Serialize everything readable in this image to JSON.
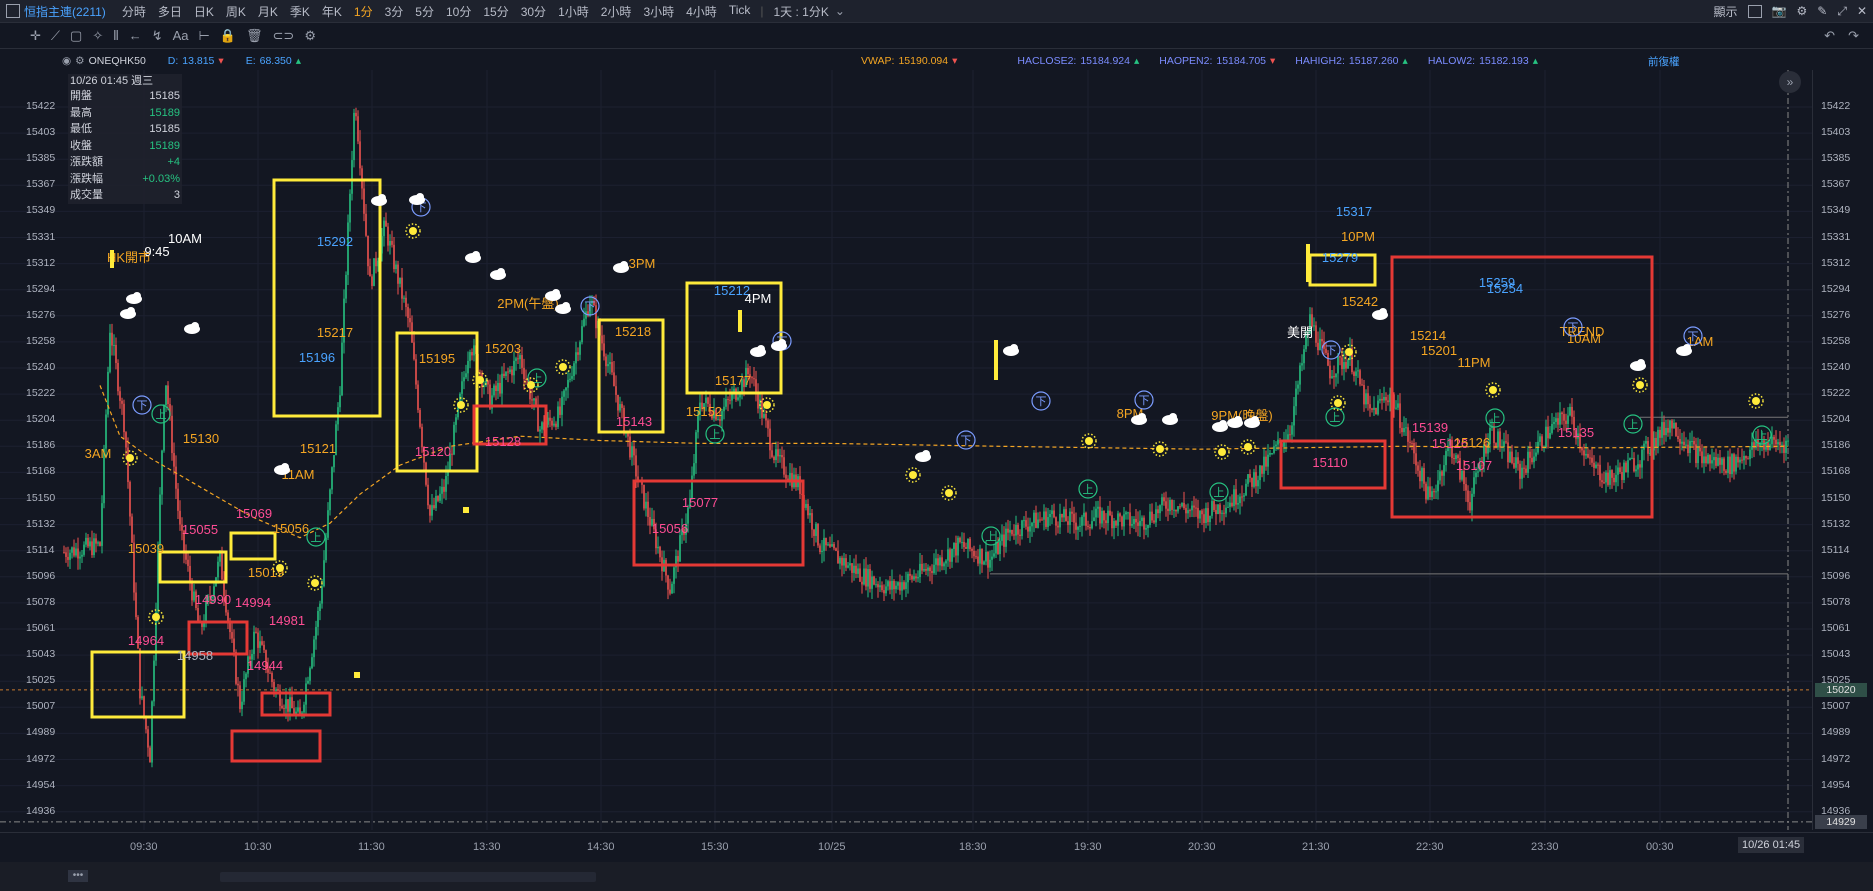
{
  "header": {
    "symbol": "恒指主連(2211)",
    "intervals": [
      "分時",
      "多日",
      "日K",
      "周K",
      "月K",
      "季K",
      "年K",
      "1分",
      "3分",
      "5分",
      "10分",
      "15分",
      "30分",
      "1小時",
      "2小時",
      "3小時",
      "4小時",
      "Tick"
    ],
    "active_interval": "1分",
    "period_select": "1天 : 1分K",
    "display_label": "顯示"
  },
  "indicator_bar": {
    "symbol": "ONEQHK50",
    "d_label": "D:",
    "d_value": "13.815",
    "e_label": "E:",
    "e_value": "68.350",
    "vwap_label": "VWAP:",
    "vwap_value": "15190.094",
    "haclose_label": "HACLOSE2:",
    "haclose_value": "15184.924",
    "haopen_label": "HAOPEN2:",
    "haopen_value": "15184.705",
    "hahigh_label": "HAHIGH2:",
    "hahigh_value": "15187.260",
    "halow_label": "HALOW2:",
    "halow_value": "15182.193",
    "adjust_label": "前復權"
  },
  "ohlc_panel": {
    "date": "10/26 01:45 週三",
    "rows": [
      {
        "label": "開盤",
        "value": "15185",
        "color": "#d0d3dc"
      },
      {
        "label": "最高",
        "value": "15189",
        "color": "#26c281"
      },
      {
        "label": "最低",
        "value": "15185",
        "color": "#d0d3dc"
      },
      {
        "label": "收盤",
        "value": "15189",
        "color": "#26c281"
      },
      {
        "label": "漲跌額",
        "value": "+4",
        "color": "#26c281"
      },
      {
        "label": "漲跌幅",
        "value": "+0.03%",
        "color": "#26c281"
      },
      {
        "label": "成交量",
        "value": "3",
        "color": "#d0d3dc"
      }
    ]
  },
  "y_axis": {
    "ticks": [
      "15422",
      "15403",
      "15385",
      "15367",
      "15349",
      "15331",
      "15312",
      "15294",
      "15276",
      "15258",
      "15240",
      "15222",
      "15204",
      "15186",
      "15168",
      "15150",
      "15132",
      "15114",
      "15096",
      "15078",
      "15061",
      "15043",
      "15025",
      "15007",
      "14989",
      "14972",
      "14954",
      "14936"
    ],
    "current_price": "15020",
    "low_price": "14929"
  },
  "x_axis": {
    "ticks": [
      "09:30",
      "10:30",
      "11:30",
      "13:30",
      "14:30",
      "15:30",
      "10/25",
      "18:30",
      "19:30",
      "20:30",
      "21:30",
      "22:30",
      "23:30",
      "00:30"
    ],
    "cursor_label": "10/26 01:45"
  },
  "colors": {
    "up": "#26c281",
    "down": "#ef5350",
    "vwap": "#f5a623",
    "yellow_box": "#ffeb3b",
    "red_box": "#e53935"
  },
  "chart_data": {
    "type": "candlestick",
    "price_range": [
      14920,
      15430
    ],
    "time_labels_annotations": [
      {
        "text": "3AM",
        "price": 15110,
        "color": "#f5a623"
      },
      {
        "text": "HK開市",
        "price": 15255,
        "color": "#f5a623"
      },
      {
        "text": "9:45",
        "price": 15258,
        "color": "#ffffff"
      },
      {
        "text": "10AM",
        "price": 15288,
        "color": "#ffffff"
      },
      {
        "text": "11AM",
        "price": 15098,
        "color": "#f5a623"
      },
      {
        "text": "2PM(午盤)",
        "price": 15235,
        "color": "#f5a623"
      },
      {
        "text": "3PM",
        "price": 15268,
        "color": "#f5a623"
      },
      {
        "text": "4PM",
        "price": 15234,
        "color": "#ffffff"
      },
      {
        "text": "8PM",
        "price": 15144,
        "color": "#f5a623"
      },
      {
        "text": "9PM(晚盤)",
        "price": 15144,
        "color": "#f5a623"
      },
      {
        "text": "10PM",
        "price": 15294,
        "color": "#f5a623"
      },
      {
        "text": "美開",
        "price": 15215,
        "color": "#ffffff"
      },
      {
        "text": "11PM",
        "price": 15186,
        "color": "#f5a623"
      },
      {
        "text": "TREND",
        "price": 15218,
        "color": "#f5a623"
      },
      {
        "text": "10AM",
        "price": 15210,
        "color": "#f5a623"
      },
      {
        "text": "1AM",
        "price": 15207,
        "color": "#f5a623"
      }
    ],
    "price_labels": [
      {
        "text": "15292",
        "price": 15292,
        "color": "#4aa3ff"
      },
      {
        "text": "15217",
        "price": 15217,
        "color": "#f5a623"
      },
      {
        "text": "15196",
        "price": 15196,
        "color": "#4aa3ff"
      },
      {
        "text": "15195",
        "price": 15195,
        "color": "#f5a623"
      },
      {
        "text": "15203",
        "price": 15203,
        "color": "#f5a623"
      },
      {
        "text": "15218",
        "price": 15218,
        "color": "#f5a623"
      },
      {
        "text": "15212",
        "price": 15252,
        "color": "#4aa3ff"
      },
      {
        "text": "15177",
        "price": 15177,
        "color": "#f5a623"
      },
      {
        "text": "15152",
        "price": 15152,
        "color": "#f5a623"
      },
      {
        "text": "15130",
        "price": 15130,
        "color": "#f5a623"
      },
      {
        "text": "15121",
        "price": 15121,
        "color": "#f5a623"
      },
      {
        "text": "15039",
        "price": 15039,
        "color": "#f5a623"
      },
      {
        "text": "15056",
        "price": 15056,
        "color": "#f5a623"
      },
      {
        "text": "15019",
        "price": 15019,
        "color": "#f5a623"
      },
      {
        "text": "15317",
        "price": 15317,
        "color": "#4aa3ff"
      },
      {
        "text": "15279",
        "price": 15279,
        "color": "#4aa3ff"
      },
      {
        "text": "15242",
        "price": 15242,
        "color": "#f5a623"
      },
      {
        "text": "15214",
        "price": 15214,
        "color": "#f5a623"
      },
      {
        "text": "15201",
        "price": 15201,
        "color": "#f5a623"
      },
      {
        "text": "15259",
        "price": 15259,
        "color": "#4aa3ff"
      },
      {
        "text": "15254",
        "price": 15254,
        "color": "#4aa3ff"
      },
      {
        "text": "15126",
        "price": 15126,
        "color": "#f5a623"
      },
      {
        "text": "14958",
        "price": 14958,
        "color": "#aeb3bf"
      }
    ],
    "boxed_lows": [
      {
        "text": "14964",
        "box": "yellow"
      },
      {
        "text": "15055",
        "box": "yellow"
      },
      {
        "text": "15069",
        "box": "yellow"
      },
      {
        "text": "14990",
        "box": "red"
      },
      {
        "text": "14994",
        "box": "red"
      },
      {
        "text": "14981",
        "box": "red"
      },
      {
        "text": "14944",
        "box": "red"
      },
      {
        "text": "15120",
        "box": "yellow"
      },
      {
        "text": "15128",
        "box": "red"
      },
      {
        "text": "15143",
        "box": "yellow"
      },
      {
        "text": "15077",
        "box": "red"
      },
      {
        "text": "15056",
        "box": "red"
      },
      {
        "text": "15110",
        "box": "red"
      },
      {
        "text": "15139",
        "box": "red"
      },
      {
        "text": "15126",
        "box": "red"
      },
      {
        "text": "15107",
        "box": "red"
      },
      {
        "text": "15135",
        "box": "red"
      }
    ],
    "markers": {
      "up": "上",
      "down": "下"
    },
    "vwap_line": true,
    "reference_line_price": 15020
  }
}
